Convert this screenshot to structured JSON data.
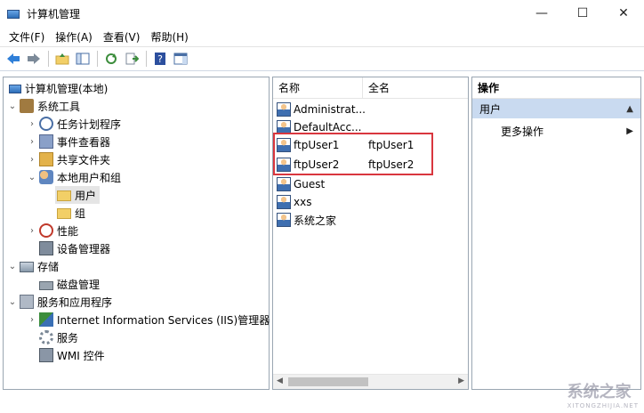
{
  "window": {
    "title": "计算机管理",
    "minimize": "—",
    "maximize": "☐",
    "close": "✕"
  },
  "menu": [
    "文件(F)",
    "操作(A)",
    "查看(V)",
    "帮助(H)"
  ],
  "toolbar": {
    "icons": [
      "back-icon",
      "forward-icon",
      "up-folder-icon",
      "show-hide-tree-icon",
      "refresh-icon",
      "export-list-icon",
      "help-icon",
      "show-hide-action-pane-icon"
    ]
  },
  "tree": {
    "root": "计算机管理(本地)",
    "system_tools": "系统工具",
    "task_scheduler": "任务计划程序",
    "event_viewer": "事件查看器",
    "shared_folders": "共享文件夹",
    "local_users_groups": "本地用户和组",
    "users": "用户",
    "groups": "组",
    "performance": "性能",
    "device_manager": "设备管理器",
    "storage": "存储",
    "disk_management": "磁盘管理",
    "services_apps": "服务和应用程序",
    "iis": "Internet Information Services (IIS)管理器",
    "services": "服务",
    "wmi": "WMI 控件"
  },
  "list": {
    "headers": {
      "name": "名称",
      "full_name": "全名"
    },
    "rows": [
      {
        "name": "Administrat...",
        "full_name": ""
      },
      {
        "name": "DefaultAcc...",
        "full_name": ""
      },
      {
        "name": "ftpUser1",
        "full_name": "ftpUser1"
      },
      {
        "name": "ftpUser2",
        "full_name": "ftpUser2"
      },
      {
        "name": "Guest",
        "full_name": ""
      },
      {
        "name": "xxs",
        "full_name": ""
      },
      {
        "name": "系统之家",
        "full_name": ""
      }
    ]
  },
  "actions": {
    "title": "操作",
    "section": "用户",
    "more": "更多操作"
  },
  "watermark": {
    "text": "系统之家",
    "sub": "XITONGZHIJIA.NET"
  },
  "colors": {
    "highlight_border": "#d9363e",
    "action_section_bg": "#c9daf0",
    "pane_border": "#9aa6b2"
  }
}
